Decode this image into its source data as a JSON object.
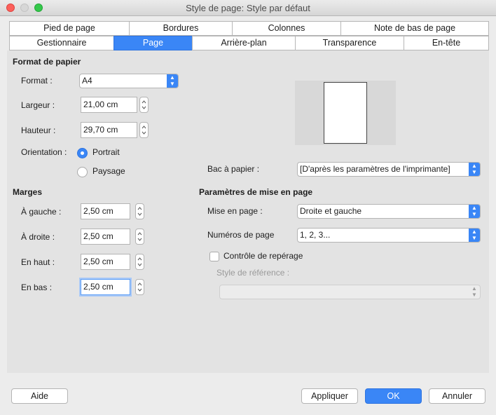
{
  "window": {
    "title": "Style de page: Style par défaut"
  },
  "tabs_row1": [
    {
      "label": "Pied de page"
    },
    {
      "label": "Bordures"
    },
    {
      "label": "Colonnes"
    },
    {
      "label": "Note de bas de page"
    }
  ],
  "tabs_row2": [
    {
      "label": "Gestionnaire"
    },
    {
      "label": "Page",
      "active": true
    },
    {
      "label": "Arrière-plan"
    },
    {
      "label": "Transparence"
    },
    {
      "label": "En-tête"
    }
  ],
  "paper": {
    "section_title": "Format de papier",
    "format_label": "Format :",
    "format_value": "A4",
    "width_label": "Largeur :",
    "width_value": "21,00 cm",
    "height_label": "Hauteur :",
    "height_value": "29,70 cm",
    "orientation_label": "Orientation :",
    "portrait_label": "Portrait",
    "landscape_label": "Paysage",
    "orientation_selected": "Portrait",
    "tray_label": "Bac à papier :",
    "tray_value": "[D'après les paramètres de l'imprimante]"
  },
  "margins": {
    "section_title": "Marges",
    "left_label": "À gauche :",
    "left_value": "2,50 cm",
    "right_label": "À droite :",
    "right_value": "2,50 cm",
    "top_label": "En haut :",
    "top_value": "2,50 cm",
    "bottom_label": "En bas :",
    "bottom_value": "2,50 cm"
  },
  "layout": {
    "section_title": "Paramètres de mise en page",
    "page_layout_label": "Mise en page :",
    "page_layout_value": "Droite et gauche",
    "page_numbers_label": "Numéros de page",
    "page_numbers_value": "1, 2, 3...",
    "register_label": "Contrôle de repérage",
    "register_checked": false,
    "reference_style_label": "Style de référence :",
    "reference_style_value": ""
  },
  "buttons": {
    "help": "Aide",
    "apply": "Appliquer",
    "ok": "OK",
    "cancel": "Annuler"
  },
  "colors": {
    "accent": "#3a86f6",
    "background": "#ececec",
    "panel": "#e3e3e3"
  }
}
